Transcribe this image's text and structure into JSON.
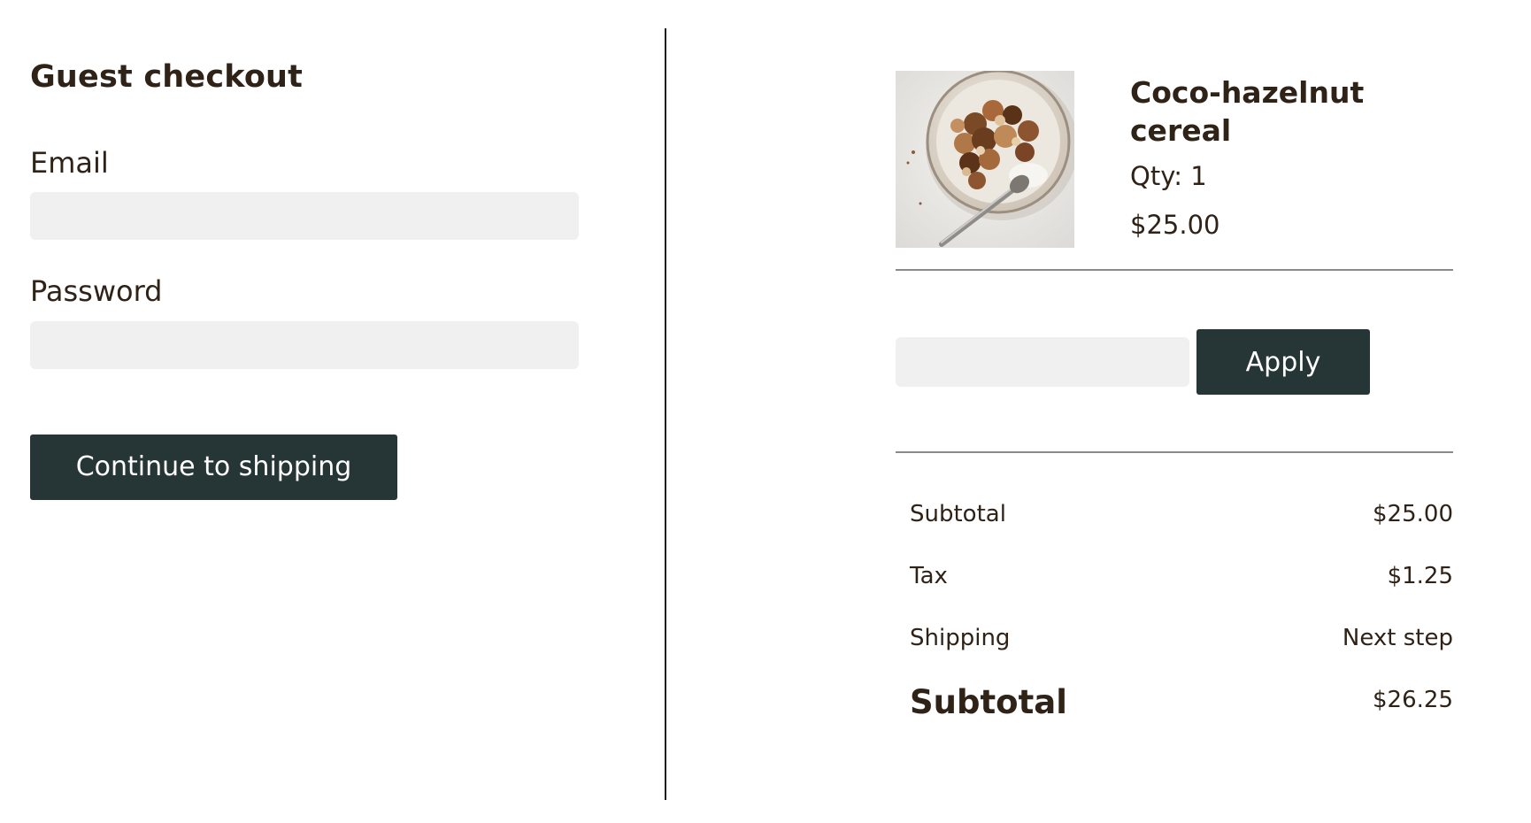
{
  "checkout": {
    "title": "Guest checkout",
    "email_label": "Email",
    "email_value": "",
    "password_label": "Password",
    "password_value": "",
    "continue_label": "Continue to shipping"
  },
  "cart_item": {
    "image_icon": "cereal-bowl-image",
    "name": "Coco-hazelnut cereal",
    "qty": "Qty: 1",
    "price": "$25.00"
  },
  "promo": {
    "value": "",
    "apply_label": "Apply"
  },
  "totals": {
    "subtotal_label": "Subtotal",
    "subtotal_value": "$25.00",
    "tax_label": "Tax",
    "tax_value": "$1.25",
    "shipping_label": "Shipping",
    "shipping_value": "Next step",
    "grand_label": "Subtotal",
    "grand_value": "$26.25"
  },
  "colors": {
    "button_bg": "#263536",
    "input_bg": "#f0f0f0",
    "text": "#2f2217"
  }
}
